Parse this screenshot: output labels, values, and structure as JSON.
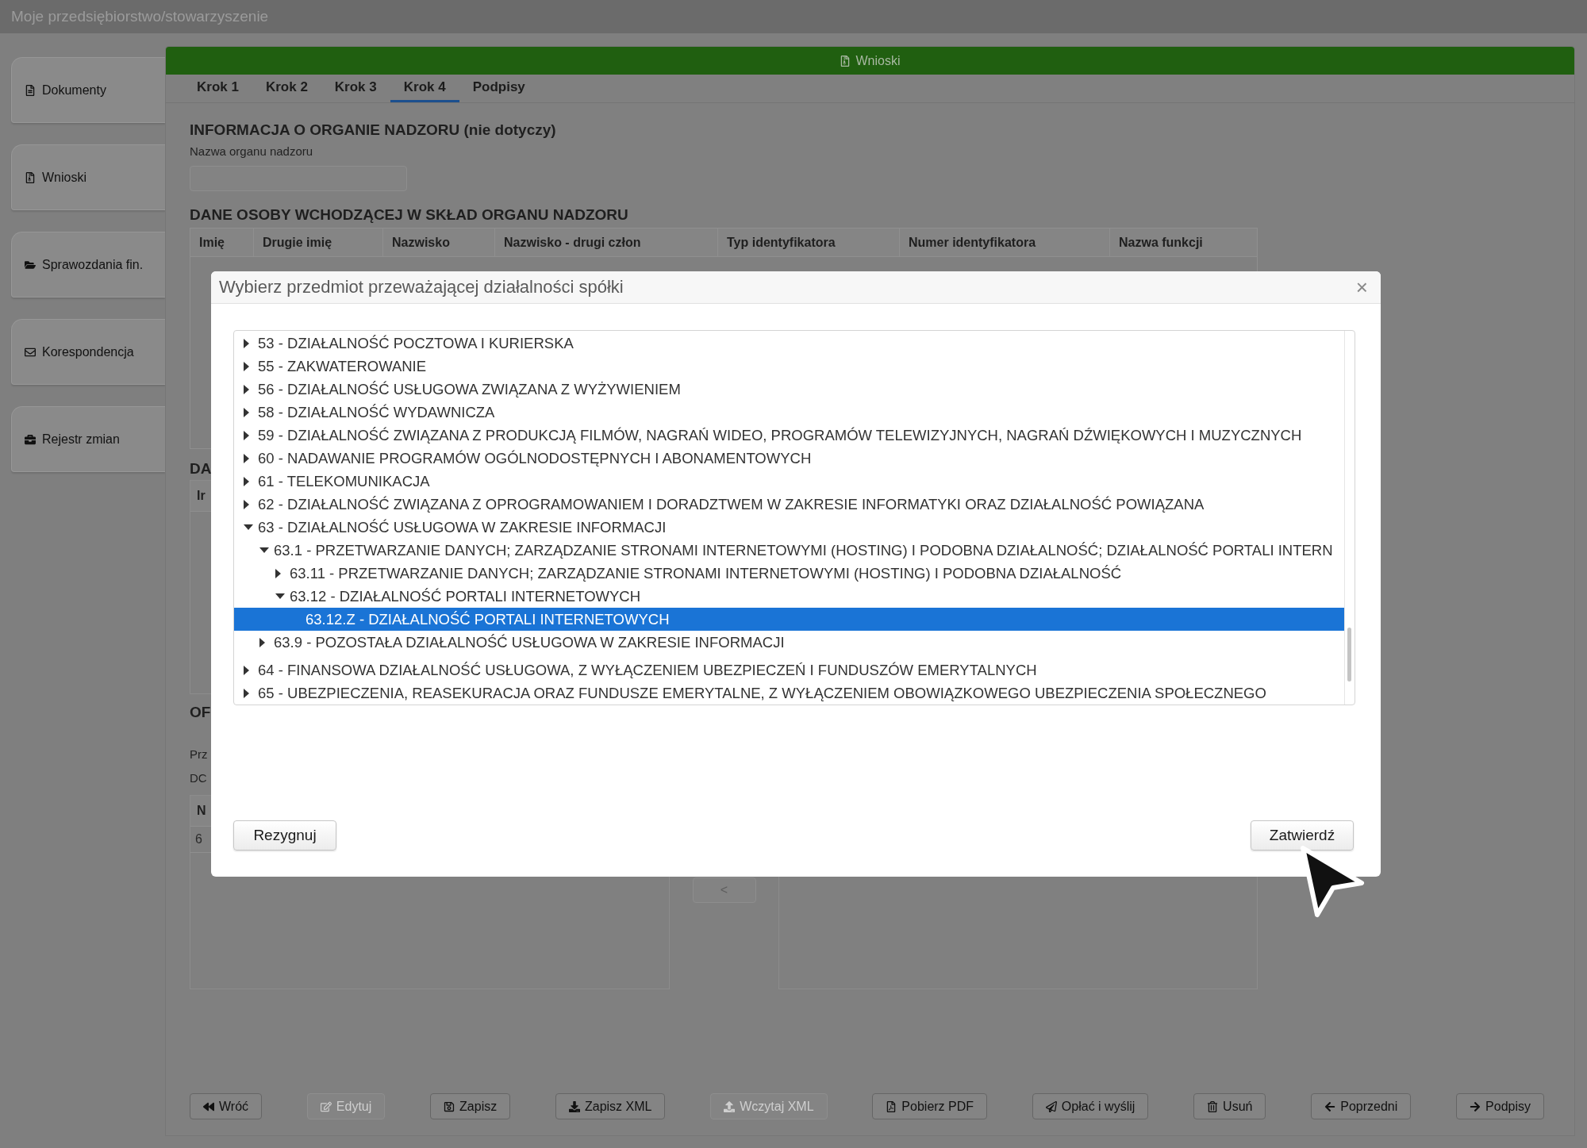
{
  "window": {
    "title": "Moje przedsiębiorstwo/stowarzyszenie"
  },
  "sidebar": {
    "items": [
      {
        "label": "Dokumenty"
      },
      {
        "label": "Wnioski"
      },
      {
        "label": "Sprawozdania fin."
      },
      {
        "label": "Korespondencja"
      },
      {
        "label": "Rejestr zmian"
      }
    ]
  },
  "panel": {
    "title": "Wnioski"
  },
  "tabs": [
    {
      "label": "Krok 1",
      "selected": false
    },
    {
      "label": "Krok 2",
      "selected": false
    },
    {
      "label": "Krok 3",
      "selected": false
    },
    {
      "label": "Krok 4",
      "selected": true
    },
    {
      "label": "Podpisy",
      "selected": false
    }
  ],
  "supervisor": {
    "heading": "INFORMACJA O ORGANIE NADZORU (nie dotyczy)",
    "field_label": "Nazwa organu nadzoru"
  },
  "members": {
    "heading": "DANE OSOBY WCHODZĄCEJ W SKŁAD ORGANU NADZORU",
    "columns": [
      "Imię",
      "Drugie imię",
      "Nazwisko",
      "Nazwisko - drugi człon",
      "Typ identyfikatora",
      "Numer identyfikatora",
      "Nazwa funkcji"
    ]
  },
  "section_3": {
    "heading": "DA",
    "column_1": "Ir"
  },
  "section_4": {
    "heading": "OF",
    "line_1": "Prz",
    "line_2": "DC",
    "column_1": "N",
    "cell_1": "6",
    "move_button": "<"
  },
  "toolbar": [
    {
      "label": "Wróć",
      "disabled": false
    },
    {
      "label": "Edytuj",
      "disabled": true
    },
    {
      "label": "Zapisz",
      "disabled": false
    },
    {
      "label": "Zapisz XML",
      "disabled": false
    },
    {
      "label": "Wczytaj XML",
      "disabled": true
    },
    {
      "label": "Pobierz PDF",
      "disabled": false
    },
    {
      "label": "Opłać i wyślij",
      "disabled": false
    },
    {
      "label": "Usuń",
      "disabled": false
    },
    {
      "label": "Poprzedni",
      "disabled": false
    },
    {
      "label": "Podpisy",
      "disabled": false
    }
  ],
  "dialog": {
    "title": "Wybierz przedmiot przeważającej działalności spółki",
    "close": "×",
    "tree": [
      {
        "label": "53 - DZIAŁALNOŚĆ POCZTOWA I KURIERSKA",
        "kind": "node",
        "expanded": false,
        "selected": false
      },
      {
        "label": "55 - ZAKWATEROWANIE",
        "kind": "node",
        "expanded": false,
        "selected": false
      },
      {
        "label": "56 - DZIAŁALNOŚĆ USŁUGOWA ZWIĄZANA Z WYŻYWIENIEM",
        "kind": "node",
        "expanded": false,
        "selected": false
      },
      {
        "label": "58 - DZIAŁALNOŚĆ WYDAWNICZA",
        "kind": "node",
        "expanded": false,
        "selected": false
      },
      {
        "label": "59 - DZIAŁALNOŚĆ ZWIĄZANA Z PRODUKCJĄ FILMÓW, NAGRAŃ WIDEO, PROGRAMÓW TELEWIZYJNYCH, NAGRAŃ DŹWIĘKOWYCH I MUZYCZNYCH",
        "kind": "node",
        "expanded": false,
        "selected": false
      },
      {
        "label": "60 - NADAWANIE PROGRAMÓW OGÓLNODOSTĘPNYCH I ABONAMENTOWYCH",
        "kind": "node",
        "expanded": false,
        "selected": false
      },
      {
        "label": "61 - TELEKOMUNIKACJA",
        "kind": "node",
        "expanded": false,
        "selected": false
      },
      {
        "label": "62 - DZIAŁALNOŚĆ ZWIĄZANA Z OPROGRAMOWANIEM I DORADZTWEM W ZAKRESIE INFORMATYKI ORAZ DZIAŁALNOŚĆ POWIĄZANA",
        "kind": "node",
        "expanded": false,
        "selected": false
      },
      {
        "label": "63 - DZIAŁALNOŚĆ USŁUGOWA W ZAKRESIE INFORMACJI",
        "kind": "node",
        "expanded": true,
        "selected": false,
        "children": [
          {
            "label": "63.1 - PRZETWARZANIE DANYCH; ZARZĄDZANIE STRONAMI INTERNETOWYMI (HOSTING) I PODOBNA DZIAŁALNOŚĆ; DZIAŁALNOŚĆ PORTALI INTERN",
            "kind": "node",
            "expanded": true,
            "selected": false,
            "children": [
              {
                "label": "63.11 - PRZETWARZANIE DANYCH; ZARZĄDZANIE STRONAMI INTERNETOWYMI (HOSTING) I PODOBNA DZIAŁALNOŚĆ",
                "kind": "node",
                "expanded": false,
                "selected": false
              },
              {
                "label": "63.12 - DZIAŁALNOŚĆ PORTALI INTERNETOWYCH",
                "kind": "node",
                "expanded": true,
                "selected": false,
                "children": [
                  {
                    "label": "63.12.Z - DZIAŁALNOŚĆ PORTALI INTERNETOWYCH",
                    "kind": "leaf",
                    "selected": true
                  }
                ]
              }
            ]
          },
          {
            "label": "63.9 - POZOSTAŁA DZIAŁALNOŚĆ USŁUGOWA W ZAKRESIE INFORMACJI",
            "kind": "node",
            "expanded": false,
            "selected": false
          }
        ]
      },
      {
        "label": "64 - FINANSOWA DZIAŁALNOŚĆ USŁUGOWA, Z WYŁĄCZENIEM UBEZPIECZEŃ I FUNDUSZÓW EMERYTALNYCH",
        "kind": "node",
        "expanded": false,
        "selected": false
      },
      {
        "label": "65 - UBEZPIECZENIA, REASEKURACJA ORAZ FUNDUSZE EMERYTALNE, Z WYŁĄCZENIEM OBOWIĄZKOWEGO UBEZPIECZENIA SPOŁECZNEGO",
        "kind": "node",
        "expanded": false,
        "selected": false
      }
    ],
    "buttons": {
      "cancel": "Rezygnuj",
      "confirm": "Zatwierdź"
    }
  }
}
